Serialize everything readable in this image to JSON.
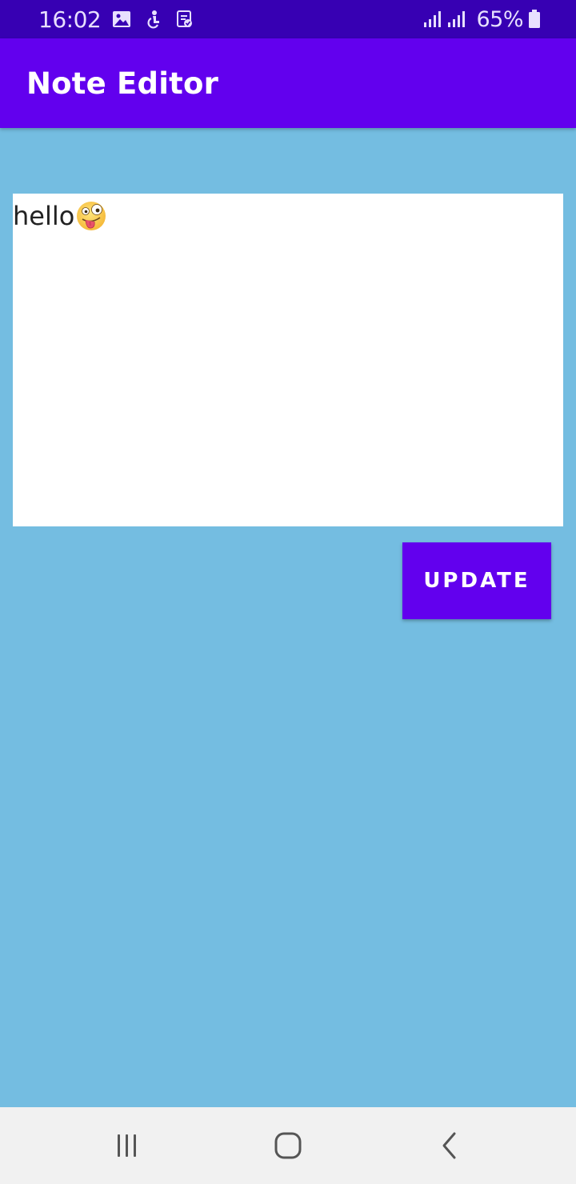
{
  "status_bar": {
    "time": "16:02",
    "battery": "65%",
    "icons": [
      "gallery-icon",
      "accessibility-icon",
      "clipboard-check-icon",
      "signal-icon",
      "signal-icon",
      "battery-icon"
    ]
  },
  "app_bar": {
    "title": "Note Editor"
  },
  "editor": {
    "text": "hello",
    "emoji": "zany-face"
  },
  "actions": {
    "update_label": "UPDATE"
  },
  "nav_bar": {
    "buttons": [
      "recents-icon",
      "home-icon",
      "back-icon"
    ]
  },
  "colors": {
    "status_bar": "#3700b3",
    "app_bar": "#6200ee",
    "background": "#74bde1",
    "button": "#6200ee",
    "nav_bar": "#f1f1f1"
  }
}
